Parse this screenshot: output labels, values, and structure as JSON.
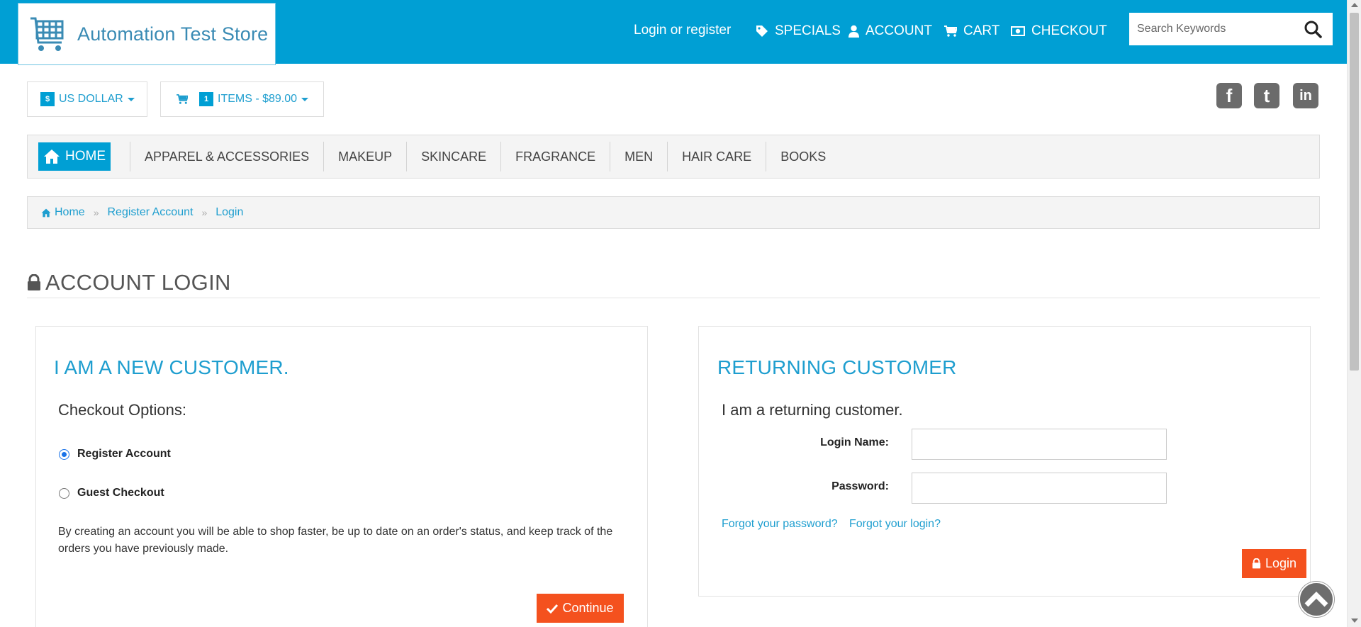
{
  "header": {
    "store_name": "Automation Test Store",
    "login_link": "Login or register",
    "nav": [
      {
        "label": "SPECIALS",
        "icon": "tag-icon"
      },
      {
        "label": "ACCOUNT",
        "icon": "user-icon"
      },
      {
        "label": "CART",
        "icon": "cart-icon"
      },
      {
        "label": "CHECKOUT",
        "icon": "money-icon"
      }
    ],
    "search_placeholder": "Search Keywords"
  },
  "currency": {
    "symbol": "$",
    "label": "US DOLLAR"
  },
  "cart_summary": {
    "count": "1",
    "label": "ITEMS - $89.00"
  },
  "social": [
    {
      "name": "facebook",
      "glyph": "f"
    },
    {
      "name": "twitter",
      "glyph": "t"
    },
    {
      "name": "linkedin",
      "glyph": "in"
    }
  ],
  "categories": {
    "home": "HOME",
    "items": [
      "APPAREL & ACCESSORIES",
      "MAKEUP",
      "SKINCARE",
      "FRAGRANCE",
      "MEN",
      "HAIR CARE",
      "BOOKS"
    ]
  },
  "breadcrumb": [
    "Home",
    "Register Account",
    "Login"
  ],
  "page_title": "ACCOUNT LOGIN",
  "new_customer": {
    "heading": "I AM A NEW CUSTOMER.",
    "checkout_options": "Checkout Options:",
    "options": [
      {
        "label": "Register Account",
        "selected": true
      },
      {
        "label": "Guest Checkout",
        "selected": false
      }
    ],
    "description": "By creating an account you will be able to shop faster, be up to date on an order's status, and keep track of the orders you have previously made.",
    "continue_label": "Continue"
  },
  "returning_customer": {
    "heading": "RETURNING CUSTOMER",
    "subheading": "I am a returning customer.",
    "login_name_label": "Login Name:",
    "login_name_value": "",
    "password_label": "Password:",
    "password_value": "",
    "forgot_password": "Forgot your password?",
    "forgot_login": "Forgot your login?",
    "login_label": "Login"
  },
  "colors": {
    "brand": "#009fd4",
    "accent": "#f4511e",
    "link": "#1e9ecf"
  }
}
